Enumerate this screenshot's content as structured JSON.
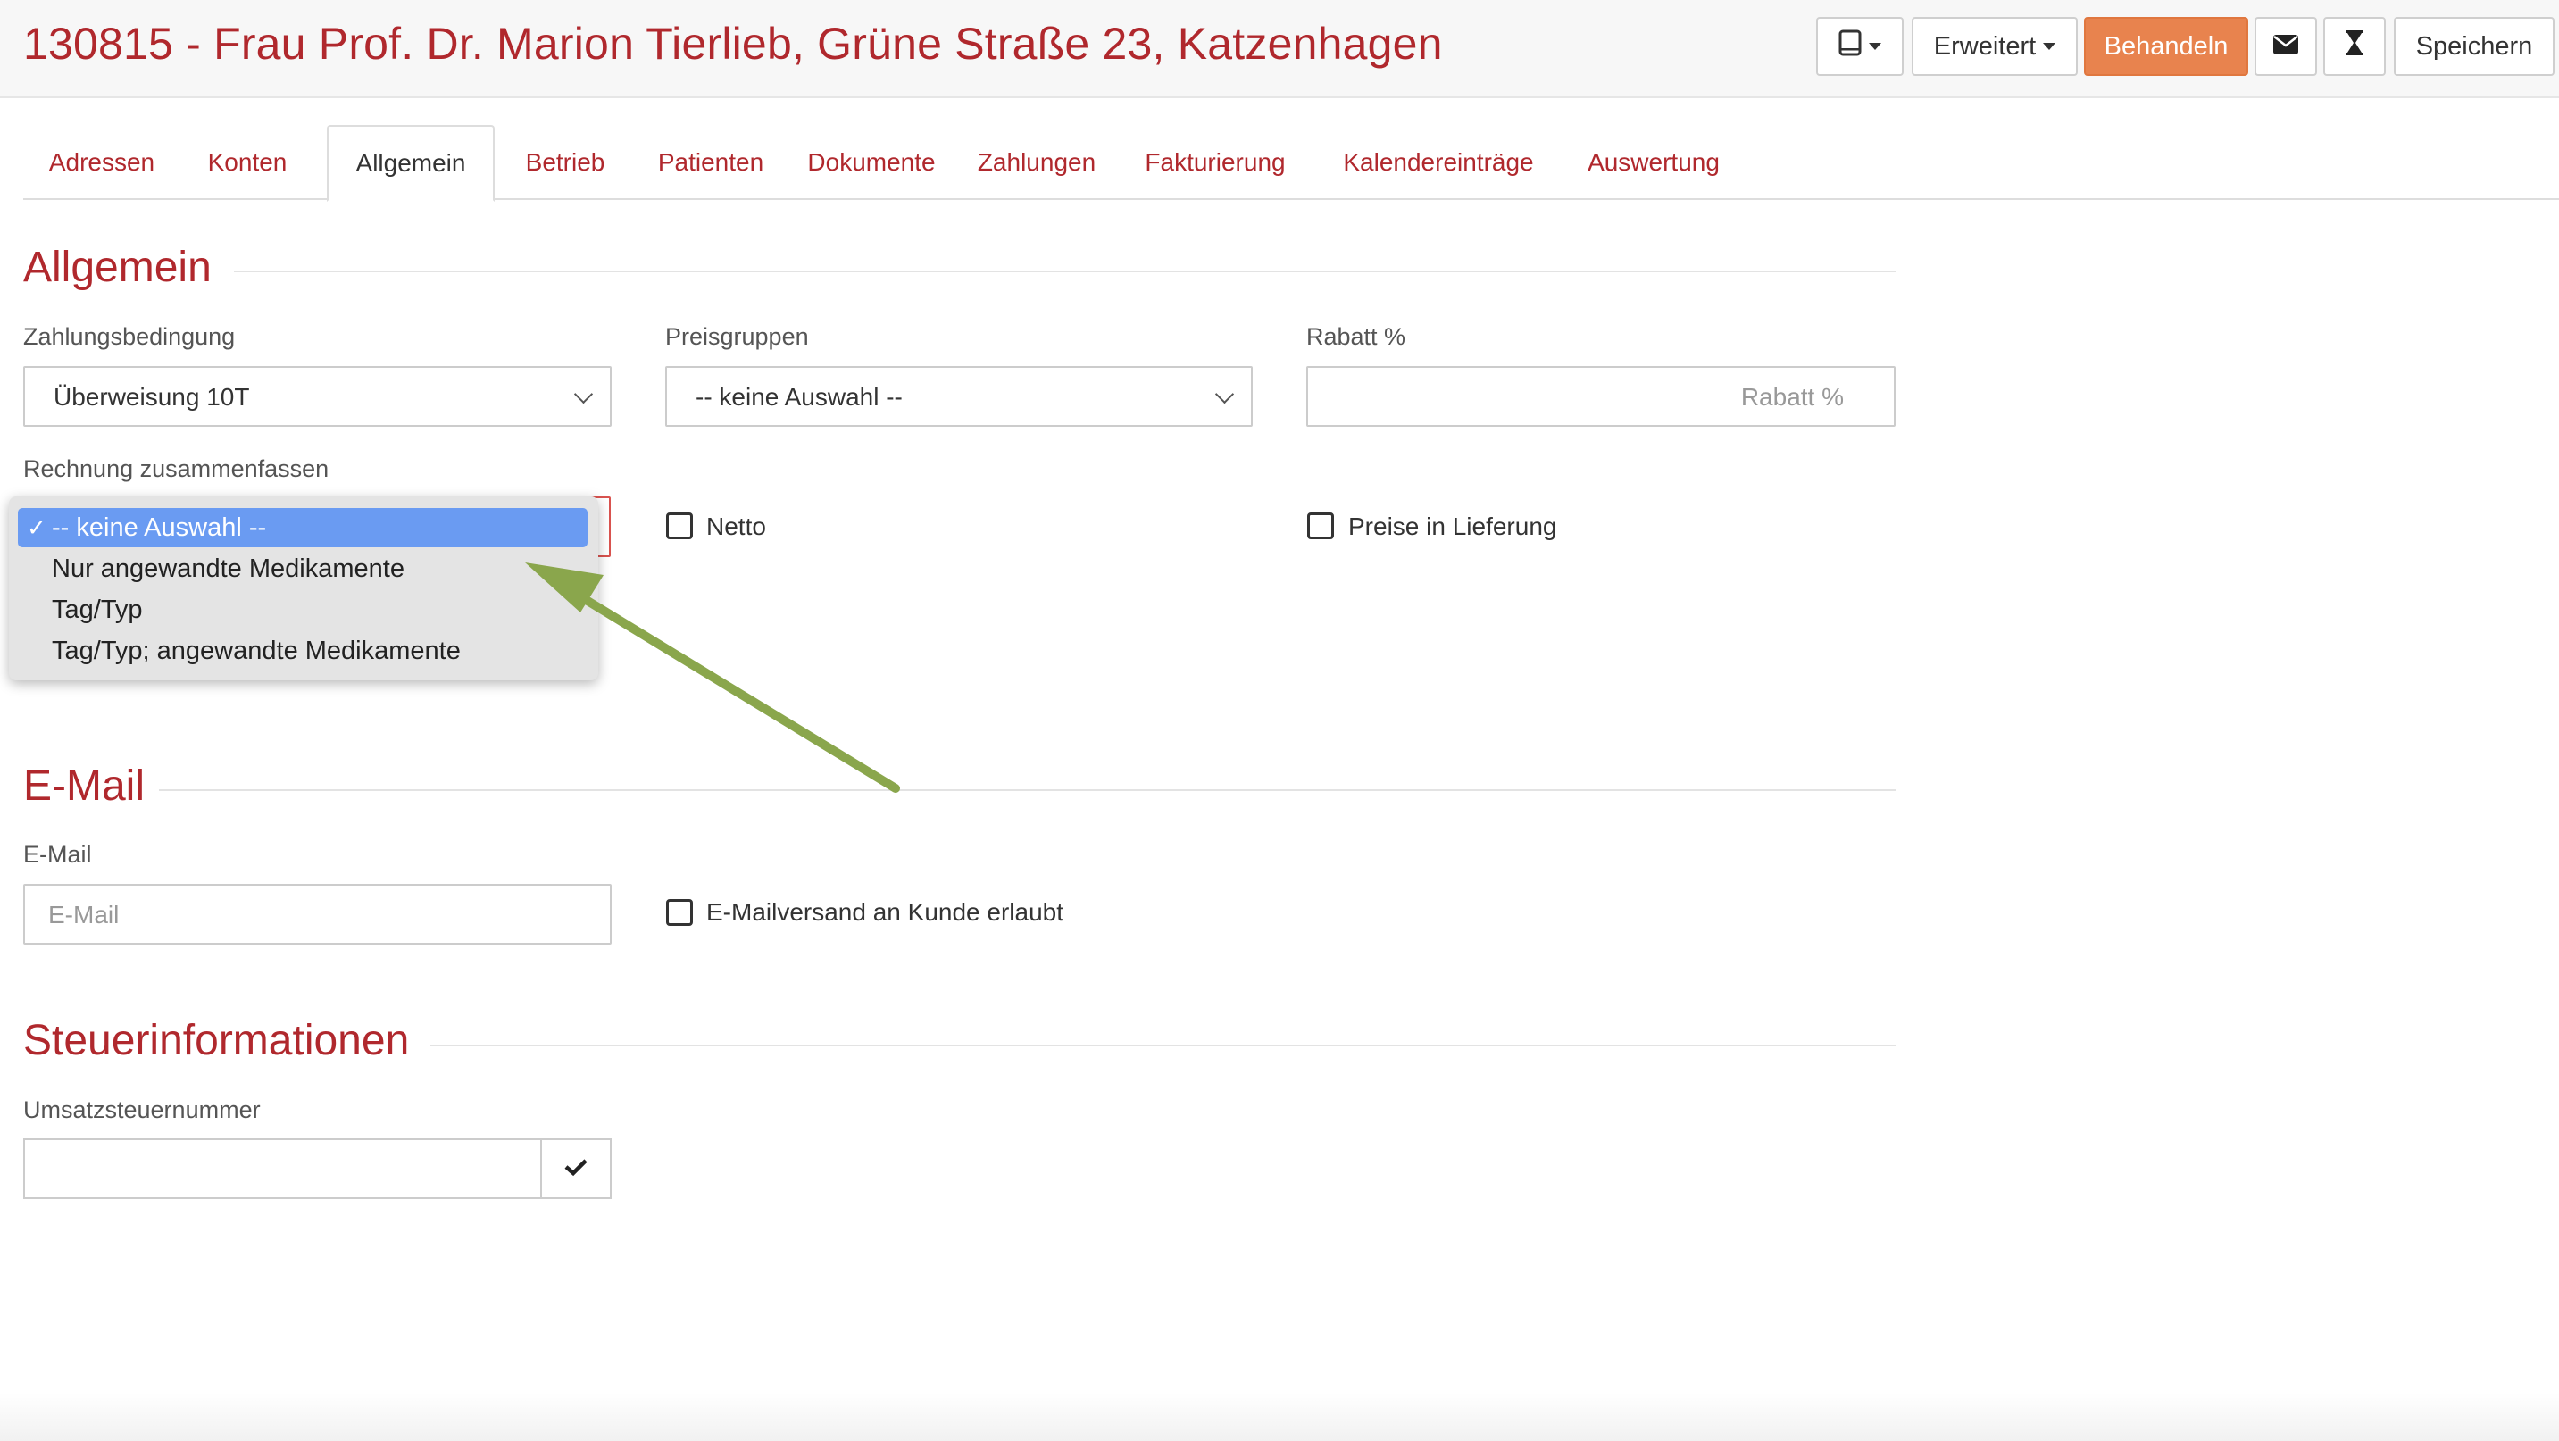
{
  "header": {
    "title": "130815 - Frau Prof. Dr. Marion Tierlieb, Grüne Straße 23, Katzenhagen",
    "buttons": {
      "erweitert": "Erweitert",
      "behandeln": "Behandeln",
      "speichern": "Speichern"
    }
  },
  "tabs": [
    {
      "label": "Adressen"
    },
    {
      "label": "Konten"
    },
    {
      "label": "Allgemein"
    },
    {
      "label": "Betrieb"
    },
    {
      "label": "Patienten"
    },
    {
      "label": "Dokumente"
    },
    {
      "label": "Zahlungen"
    },
    {
      "label": "Fakturierung"
    },
    {
      "label": "Kalendereinträge"
    },
    {
      "label": "Auswertung"
    }
  ],
  "active_tab": "Allgemein",
  "allgemein": {
    "title": "Allgemein",
    "zahlungsbedingung": {
      "label": "Zahlungsbedingung",
      "value": "Überweisung 10T"
    },
    "preisgruppen": {
      "label": "Preisgruppen",
      "value": "-- keine Auswahl --"
    },
    "rabatt": {
      "label": "Rabatt %",
      "placeholder": "Rabatt %"
    },
    "rechnung": {
      "label": "Rechnung zusammenfassen",
      "options": [
        "-- keine Auswahl --",
        "Nur angewandte Medikamente",
        "Tag/Typ",
        "Tag/Typ; angewandte Medikamente"
      ],
      "selected": "-- keine Auswahl --"
    },
    "netto": {
      "label": "Netto",
      "checked": false
    },
    "preise_in_lieferung": {
      "label": "Preise in Lieferung",
      "checked": false
    }
  },
  "email": {
    "title": "E-Mail",
    "label": "E-Mail",
    "placeholder": "E-Mail",
    "versand": {
      "label": "E-Mailversand an Kunde erlaubt",
      "checked": false
    }
  },
  "steuer": {
    "title": "Steuerinformationen",
    "ust_label": "Umsatzsteuernummer",
    "ust_value": ""
  },
  "colors": {
    "brand_red": "#b0282d",
    "primary_orange": "#e8834e",
    "selection_blue": "#6a9bf2",
    "annotation_arrow": "#8aa64c"
  }
}
